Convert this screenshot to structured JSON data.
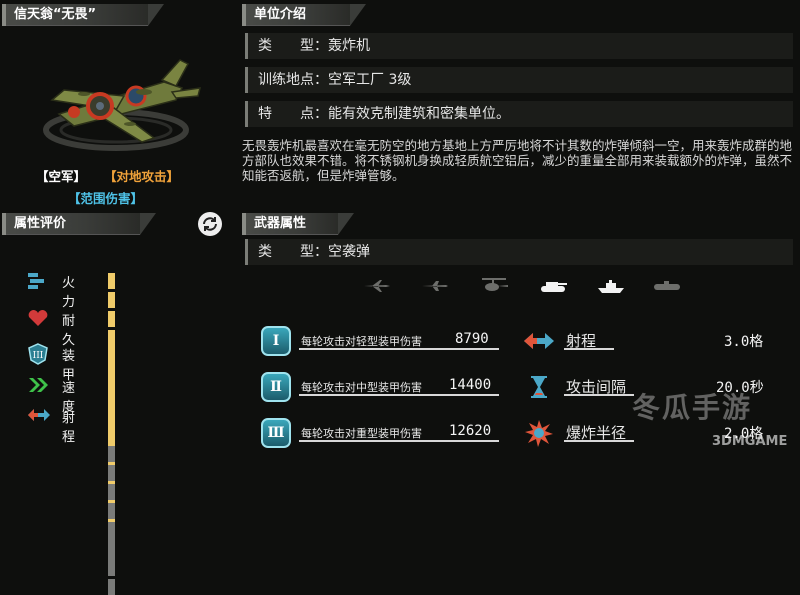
{
  "unit": {
    "name": "信天翁“无畏”",
    "tags": [
      "【空军】",
      "【对地攻击】",
      "【范围伤害】"
    ],
    "tag_colors": [
      "#ffffff",
      "#f0a23a",
      "#4fc3e8"
    ]
  },
  "intro": {
    "header": "单位介绍",
    "type_label": "类　　型：",
    "type_value": "轰炸机",
    "train_label": "训练地点：",
    "train_value": "空军工厂 3级",
    "feature_label": "特　　点：",
    "feature_value": "能有效克制建筑和密集单位。",
    "description": "无畏轰炸机最喜欢在毫无防空的地方基地上方严厉地将不计其数的炸弹倾斜一空，用来轰炸成群的地方部队也效果不错。将不锈钢机身换成轻质航空铝后，减少的重量全部用来装载额外的炸弹，虽然不知能否返航，但是炸弹管够。"
  },
  "ratings": {
    "header": "属性评价",
    "stats": [
      {
        "label": "火力",
        "icon": "firepower-icon",
        "filled": 10,
        "total": 10
      },
      {
        "label": "耐久",
        "icon": "heart-icon",
        "filled": 4,
        "total": 10
      },
      {
        "label": "装甲",
        "icon": "armor-icon",
        "filled": 5,
        "total": 10
      },
      {
        "label": "速度",
        "icon": "speed-icon",
        "filled": 8,
        "total": 10
      },
      {
        "label": "射程",
        "icon": "range-icon",
        "filled": 2,
        "total": 10
      }
    ]
  },
  "weapon": {
    "header": "武器属性",
    "type_label": "类　　型：",
    "type_value": "空袭弹",
    "targets": [
      "jet-icon",
      "plane-icon",
      "helicopter-icon",
      "tank-icon",
      "ship-icon",
      "submarine-icon"
    ],
    "active_target": "tank-icon",
    "damage": [
      {
        "roman": "Ⅰ",
        "label": "每轮攻击对轻型装甲伤害",
        "value": "8790"
      },
      {
        "roman": "Ⅱ",
        "label": "每轮攻击对中型装甲伤害",
        "value": "14400"
      },
      {
        "roman": "Ⅲ",
        "label": "每轮攻击对重型装甲伤害",
        "value": "12620"
      }
    ],
    "props": [
      {
        "icon": "range-icon",
        "label": "射程",
        "value": "3.0格"
      },
      {
        "icon": "hourglass-icon",
        "label": "攻击间隔",
        "value": "20.0秒"
      },
      {
        "icon": "explosion-icon",
        "label": "爆炸半径",
        "value": "2.0格"
      }
    ]
  },
  "watermark": {
    "text1": "冬瓜手游",
    "text2": "3DMGAME"
  }
}
